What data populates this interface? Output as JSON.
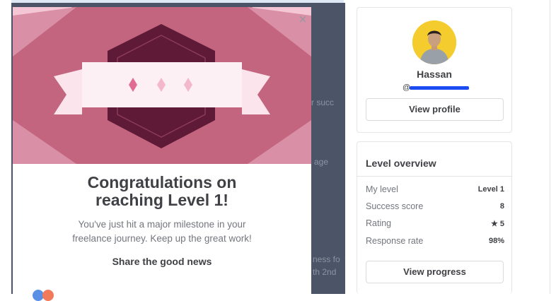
{
  "modal": {
    "close_glyph": "×",
    "title_line1": "Congratulations on",
    "title_line2": "reaching Level 1!",
    "body_line1": "You've just hit a major milestone in your",
    "body_line2": "freelance journey. Keep up the great work!",
    "share_label": "Share the good news"
  },
  "background_fragments": {
    "line1": "r succ",
    "line2": "age",
    "line3": "ness fo",
    "line4": "th 2nd"
  },
  "profile": {
    "name": "Hassan",
    "handle_prefix": "@",
    "button_label": "View profile"
  },
  "level_overview": {
    "title": "Level overview",
    "rows": [
      {
        "label": "My level",
        "value": "Level 1"
      },
      {
        "label": "Success score",
        "value": "8"
      },
      {
        "label": "Rating",
        "value": "★ 5"
      },
      {
        "label": "Response rate",
        "value": "98%"
      }
    ],
    "button_label": "View progress"
  },
  "colors": {
    "banner_bg": "#f5c7d6",
    "banner_band": "#c4657f",
    "hexagon": "#5e1a36",
    "avatar_bg": "#f4cc2e",
    "redaction": "#1a4cf2"
  }
}
